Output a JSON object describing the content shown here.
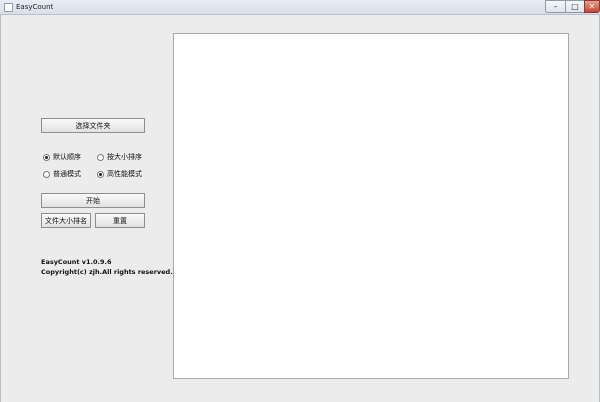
{
  "window": {
    "title": "EasyCount",
    "min_symbol": "–",
    "max_symbol": "□",
    "close_symbol": "✕"
  },
  "controls": {
    "select_folder_label": "选择文件夹",
    "start_label": "开始",
    "file_size_rank_label": "文件大小排名",
    "reset_label": "重置"
  },
  "sort_options": [
    {
      "label": "默认顺序",
      "checked": true
    },
    {
      "label": "按大小排序",
      "checked": false
    }
  ],
  "mode_options": [
    {
      "label": "普通模式",
      "checked": false
    },
    {
      "label": "高性能模式",
      "checked": true
    }
  ],
  "about": {
    "version": "EasyCount v1.0.9.6",
    "copyright": "Copyright(c) zjh.All rights reserved."
  },
  "output": {
    "content": ""
  }
}
